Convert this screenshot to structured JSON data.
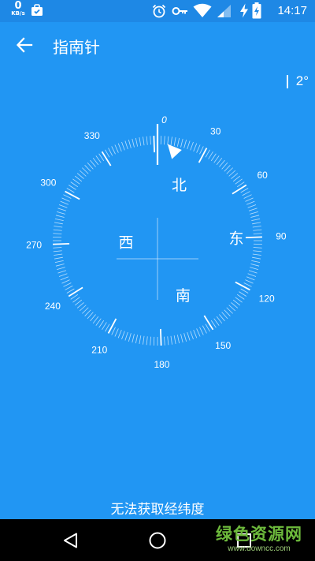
{
  "status_bar": {
    "net_speed_value": "0",
    "net_speed_unit": "KB/s",
    "icons": [
      "bag-notification-icon",
      "alarm-icon",
      "key-icon",
      "wifi-icon",
      "signal-icon",
      "battery-charging-icon"
    ],
    "time": "14:17"
  },
  "app_bar": {
    "back_icon": "arrow-left-icon",
    "title": "指南针"
  },
  "heading": {
    "degrees": 2,
    "label": "2°"
  },
  "compass": {
    "degree_labels": [
      {
        "angle": 0,
        "text": "0"
      },
      {
        "angle": 30,
        "text": "30"
      },
      {
        "angle": 60,
        "text": "60"
      },
      {
        "angle": 90,
        "text": "90"
      },
      {
        "angle": 120,
        "text": "120"
      },
      {
        "angle": 150,
        "text": "150"
      },
      {
        "angle": 180,
        "text": "180"
      },
      {
        "angle": 210,
        "text": "210"
      },
      {
        "angle": 240,
        "text": "240"
      },
      {
        "angle": 270,
        "text": "270"
      },
      {
        "angle": 300,
        "text": "300"
      },
      {
        "angle": 330,
        "text": "330"
      }
    ],
    "cardinals": [
      {
        "angle": 0,
        "text": "北"
      },
      {
        "angle": 90,
        "text": "东"
      },
      {
        "angle": 180,
        "text": "南"
      },
      {
        "angle": 270,
        "text": "西"
      }
    ]
  },
  "location_status": "无法获取经纬度",
  "nav_bar": {
    "back_icon": "nav-back-icon",
    "home_icon": "nav-home-icon",
    "recents_icon": "nav-recents-icon"
  },
  "watermark": {
    "main": "绿色资源网",
    "sub": "www.downcc.com"
  },
  "colors": {
    "background": "#2196F3",
    "status_bar": "#1E88E5",
    "foreground": "#FFFFFF",
    "watermark": "#6DBA3C"
  }
}
